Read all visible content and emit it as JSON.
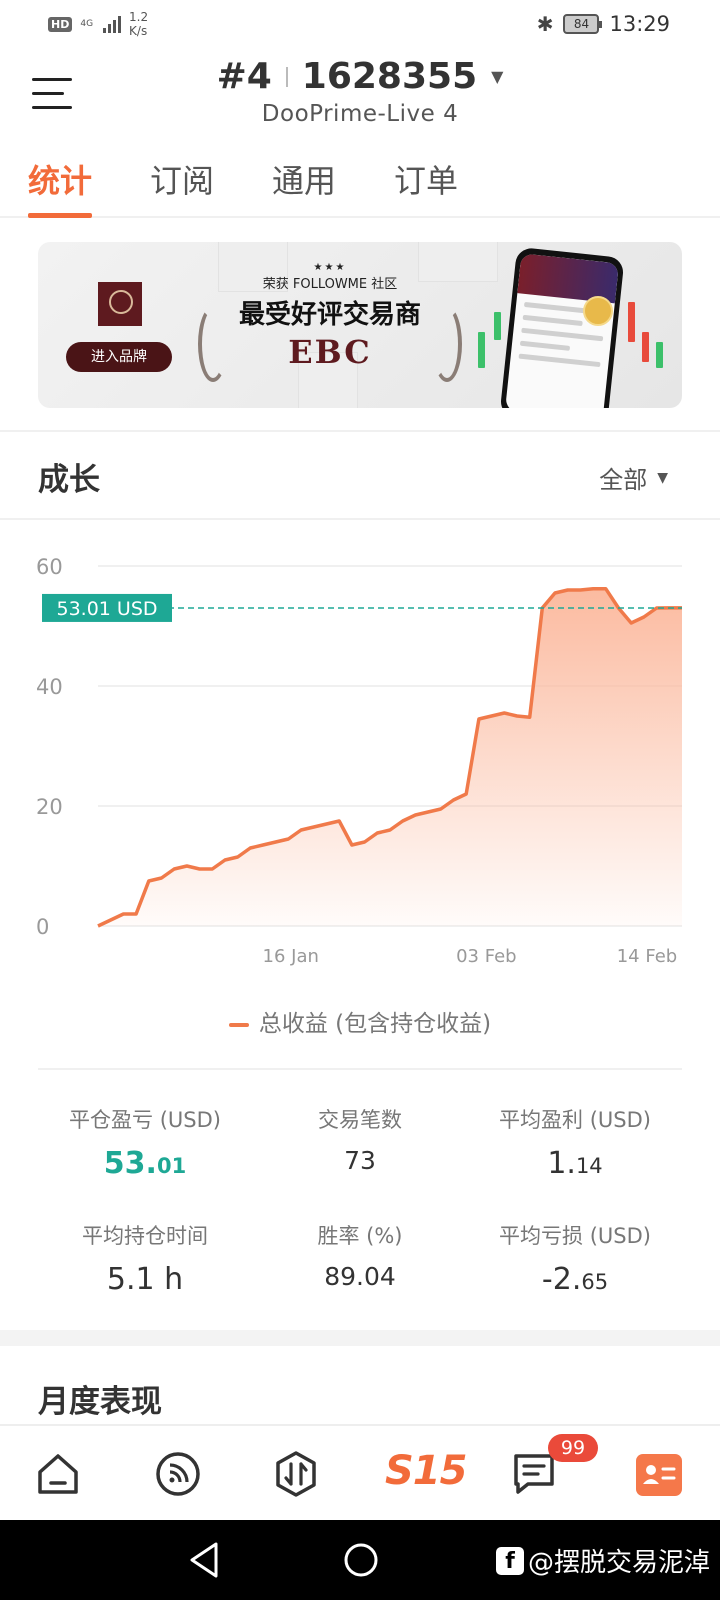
{
  "status_bar": {
    "hd": "HD",
    "network": "4G",
    "speed_value": "1.2",
    "speed_unit": "K/s",
    "battery": "84",
    "time": "13:29"
  },
  "header": {
    "account_prefix": "#4",
    "account_number": "1628355",
    "server": "DooPrime-Live 4"
  },
  "tabs": [
    {
      "label": "统计",
      "active": true
    },
    {
      "label": "订阅",
      "active": false
    },
    {
      "label": "通用",
      "active": false
    },
    {
      "label": "订单",
      "active": false
    }
  ],
  "banner": {
    "button_label": "进入品牌",
    "award_subtitle": "荣获 FOLLOWME 社区",
    "award_title": "最受好评交易商",
    "brand": "EBC"
  },
  "growth": {
    "title": "成长",
    "range": "全部",
    "current_label": "53.01 USD",
    "legend": "总收益 (包含持仓收益)"
  },
  "chart_data": {
    "type": "area",
    "x_tick_labels": [
      "16 Jan",
      "03 Feb",
      "14 Feb"
    ],
    "y_tick_labels": [
      "0",
      "20",
      "40",
      "60"
    ],
    "ylim": [
      0,
      60
    ],
    "grid": true,
    "line_color": "#f07a4a",
    "fill_color": "#fbb79b",
    "reference_line": {
      "value": 53.01,
      "color": "#1ea895",
      "label": "53.01 USD"
    },
    "series": [
      {
        "name": "总收益 (包含持仓收益)",
        "x": [
          0,
          1,
          2,
          3,
          4,
          5,
          6,
          7,
          8,
          9,
          10,
          11,
          12,
          13,
          14,
          15,
          16,
          17,
          18,
          19,
          20,
          21,
          22,
          23,
          24,
          25,
          26,
          27,
          28,
          29,
          30,
          31,
          32,
          33,
          34,
          35,
          36,
          37,
          38,
          39,
          40,
          41,
          42,
          43,
          44,
          45,
          46
        ],
        "values": [
          0,
          1,
          2,
          2,
          7.5,
          8,
          9.5,
          10,
          9.5,
          9.5,
          11,
          11.5,
          13,
          13.5,
          14,
          14.5,
          16,
          16.5,
          17,
          17.5,
          13.5,
          14,
          15.5,
          16,
          17.5,
          18.5,
          19,
          19.5,
          21,
          22,
          34.5,
          35,
          35.5,
          35,
          34.8,
          53,
          55.5,
          56,
          56,
          56.2,
          56.2,
          53,
          50.5,
          51.5,
          53,
          53.01,
          53.01
        ]
      }
    ]
  },
  "stats": {
    "closed_pl": {
      "label": "平仓盈亏 (USD)",
      "int": "53.",
      "dec": "01"
    },
    "trades": {
      "label": "交易笔数",
      "value": "73"
    },
    "avg_profit": {
      "label": "平均盈利 (USD)",
      "int": "1.",
      "dec": "14"
    },
    "avg_hold": {
      "label": "平均持仓时间",
      "value": "5.1 h"
    },
    "win_rate": {
      "label": "胜率 (%)",
      "value": "89.04"
    },
    "avg_loss": {
      "label": "平均亏损 (USD)",
      "int": "-2.",
      "dec": "65"
    }
  },
  "monthly": {
    "title": "月度表现"
  },
  "bottom_nav": {
    "items": [
      "home-icon",
      "feed-icon",
      "trade-icon",
      "s15",
      "messages-icon",
      "profile-icon"
    ],
    "s15_label": "S15",
    "messages_badge": "99"
  },
  "watermark": "@摆脱交易泥淖"
}
